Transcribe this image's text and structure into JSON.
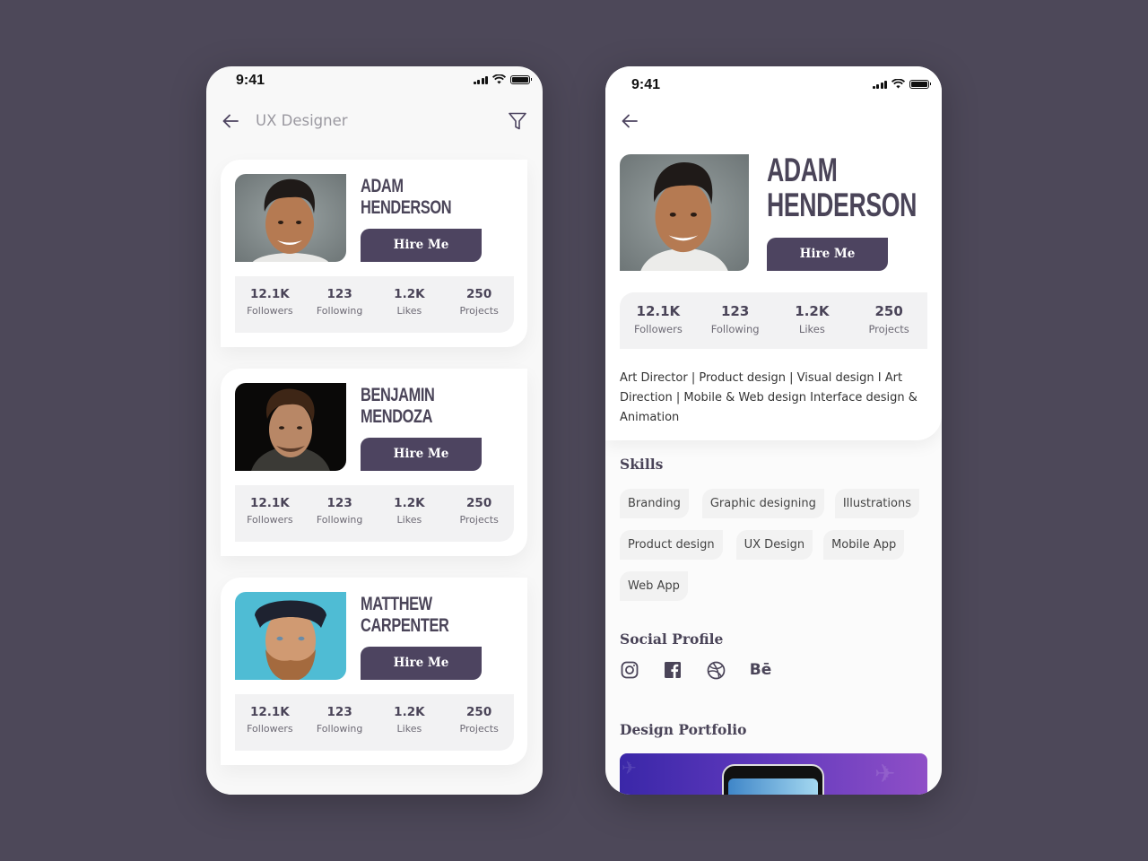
{
  "colors": {
    "background": "#4d4859",
    "accent": "#4d4460",
    "text": "#4a4458",
    "chip_bg": "#f2f2f2"
  },
  "list_screen": {
    "status": {
      "time": "9:41"
    },
    "header": {
      "title": "UX Designer",
      "back_icon": "arrow-left-icon",
      "filter_icon": "filter-icon"
    },
    "cards": [
      {
        "first_name": "Adam",
        "last_name": "Henderson",
        "hire_label": "Hire Me",
        "stats": [
          {
            "value": "12.1K",
            "label": "Followers"
          },
          {
            "value": "123",
            "label": "Following"
          },
          {
            "value": "1.2K",
            "label": "Likes"
          },
          {
            "value": "250",
            "label": "Projects"
          }
        ]
      },
      {
        "first_name": "Benjamin",
        "last_name": "Mendoza",
        "hire_label": "Hire Me",
        "stats": [
          {
            "value": "12.1K",
            "label": "Followers"
          },
          {
            "value": "123",
            "label": "Following"
          },
          {
            "value": "1.2K",
            "label": "Likes"
          },
          {
            "value": "250",
            "label": "Projects"
          }
        ]
      },
      {
        "first_name": "Matthew",
        "last_name": "Carpenter",
        "hire_label": "Hire Me",
        "stats": [
          {
            "value": "12.1K",
            "label": "Followers"
          },
          {
            "value": "123",
            "label": "Following"
          },
          {
            "value": "1.2K",
            "label": "Likes"
          },
          {
            "value": "250",
            "label": "Projects"
          }
        ]
      }
    ]
  },
  "detail_screen": {
    "status": {
      "time": "9:41"
    },
    "profile": {
      "first_name": "Adam",
      "last_name": "Henderson",
      "hire_label": "Hire Me"
    },
    "stats": [
      {
        "value": "12.1K",
        "label": "Followers"
      },
      {
        "value": "123",
        "label": "Following"
      },
      {
        "value": "1.2K",
        "label": "Likes"
      },
      {
        "value": "250",
        "label": "Projects"
      }
    ],
    "bio": "Art Director | Product design | Visual design I Art Direction | Mobile & Web design Interface design & Animation",
    "skills_title": "Skills",
    "skills": [
      "Branding",
      "Graphic designing",
      "Illustrations",
      "Product design",
      "UX Design",
      "Mobile App",
      "Web App"
    ],
    "social_title": "Social Profile",
    "social": [
      {
        "name": "instagram-icon"
      },
      {
        "name": "facebook-icon"
      },
      {
        "name": "dribbble-icon"
      },
      {
        "name": "behance-icon",
        "glyph": "Bē"
      }
    ],
    "portfolio_title": "Design Portfolio"
  }
}
